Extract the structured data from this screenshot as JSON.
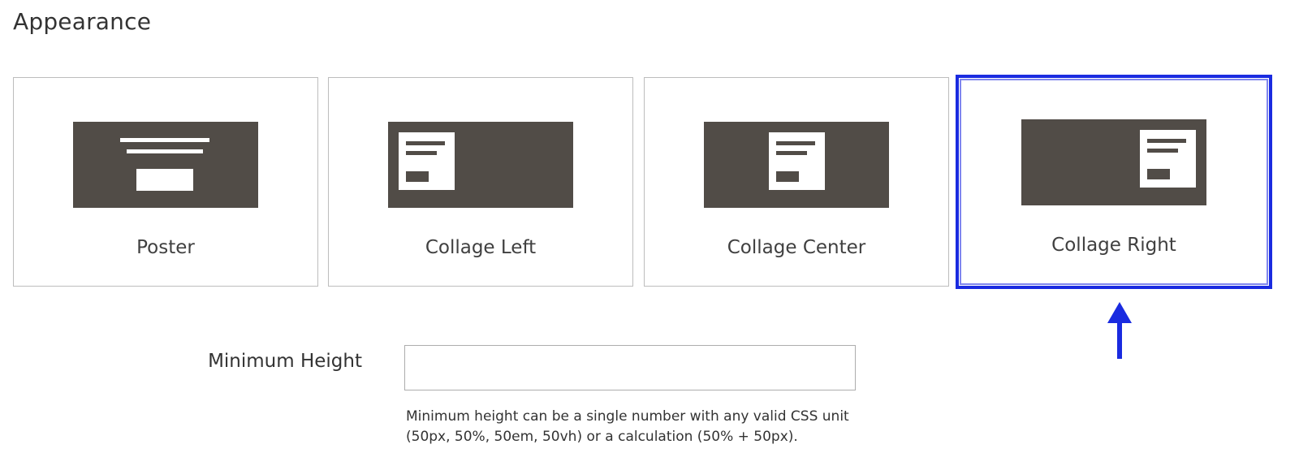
{
  "section": {
    "title": "Appearance"
  },
  "appearance_options": [
    {
      "label": "Poster",
      "selected": false
    },
    {
      "label": "Collage Left",
      "selected": false
    },
    {
      "label": "Collage Center",
      "selected": false
    },
    {
      "label": "Collage Right",
      "selected": true
    }
  ],
  "min_height": {
    "label": "Minimum Height",
    "value": "",
    "placeholder": "",
    "note": "Minimum height can be a single number with any valid CSS unit (50px, 50%, 50em, 50vh) or a calculation (50% + 50px)."
  },
  "colors": {
    "selection_outline": "#1a2be0",
    "thumbnail_bg": "#514c47",
    "card_border": "#bdbdbd",
    "annotation_arrow": "#1a2be0"
  },
  "icons": {
    "poster": "poster-layout-icon",
    "collage_left": "collage-left-layout-icon",
    "collage_center": "collage-center-layout-icon",
    "collage_right": "collage-right-layout-icon",
    "annotation": "up-arrow-icon"
  }
}
